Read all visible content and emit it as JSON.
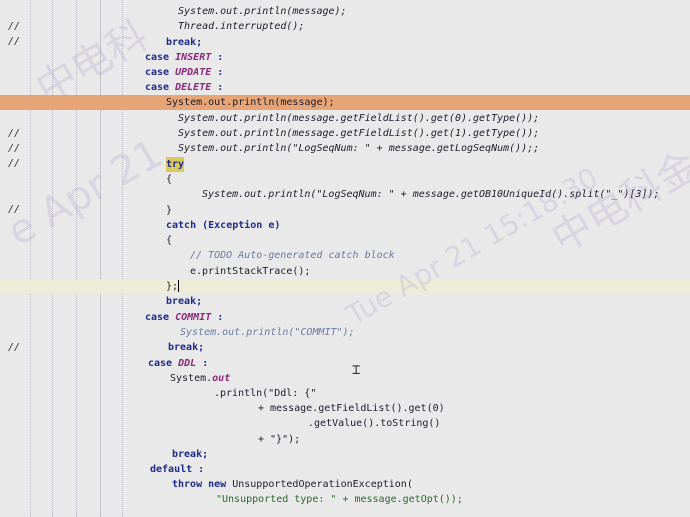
{
  "gutter_marks": [
    "//",
    "//",
    "//",
    "//",
    "//",
    "//",
    "//",
    "//"
  ],
  "code": {
    "l1": "System.out.println(message);",
    "l2": "Thread.interrupted();",
    "l3": "break;",
    "l4_kw": "case",
    "l4_const": "INSERT",
    "l4_colon": " :",
    "l5_kw": "case",
    "l5_const": "UPDATE",
    "l5_colon": " :",
    "l6_kw": "case",
    "l6_const": "DELETE",
    "l6_colon": " :",
    "l7": "System.out.println(message);",
    "l8": "System.out.println(message.getFieldList().get(0).getType());",
    "l9": "System.out.println(message.getFieldList().get(1).getType());",
    "l10": "System.out.println(\"LogSeqNum: \" + message.getLogSeqNum());;",
    "l11_try": "try",
    "l12": "{",
    "l13": "System.out.println(\"LogSeqNum: \" + message.getOB10UniqueId().split(\"_\")[3]);",
    "l14": "}",
    "l15": "catch (Exception e)",
    "l16": "{",
    "l17": "// TODO Auto-generated catch block",
    "l18": "e.printStackTrace();",
    "l19": "};",
    "l20": "break;",
    "l21_kw": "case",
    "l21_const": "COMMIT",
    "l21_colon": " :",
    "l22": "System.out.println(\"COMMIT\");",
    "l23": "break;",
    "l24_kw": "case",
    "l24_const": "DDL",
    "l24_colon": " :",
    "l25a": "System.",
    "l25b": "out",
    "l26": ".println(\"Ddl: {\"",
    "l27": "+ message.getFieldList().get(0)",
    "l28": ".getValue().toString()",
    "l29": "+ \"}\");",
    "l30": "break;",
    "l31_kw": "default",
    "l31_colon": " :",
    "l32_kw1": "throw",
    "l32_kw2": "new",
    "l32": " UnsupportedOperationException(",
    "l33": "\"Unsupported type: \" + message.getOpt());"
  },
  "watermark": [
    "中电科",
    "e Apr 21",
    "Tue Apr 21 15:18:30",
    "中电科金仓"
  ]
}
